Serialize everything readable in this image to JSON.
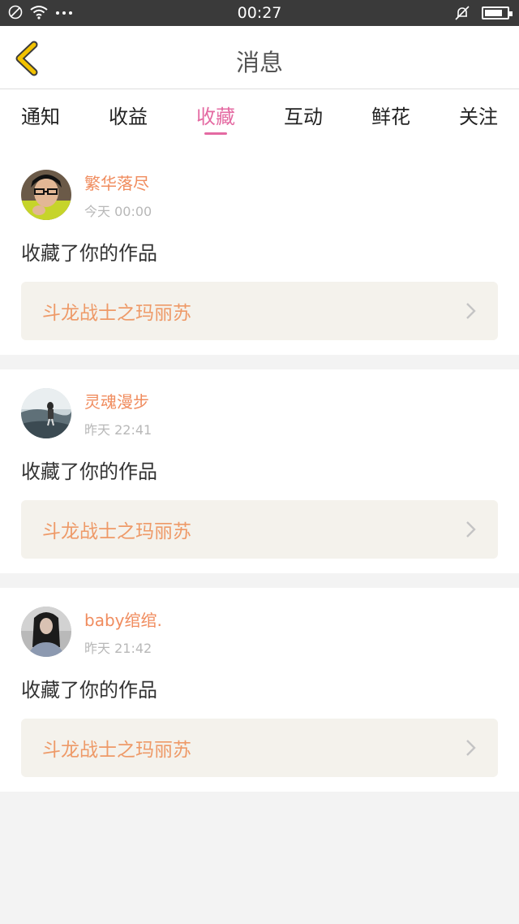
{
  "status": {
    "time": "00:27"
  },
  "nav": {
    "title": "消息"
  },
  "tabs": [
    {
      "label": "通知",
      "active": false
    },
    {
      "label": "收益",
      "active": false
    },
    {
      "label": "收藏",
      "active": true
    },
    {
      "label": "互动",
      "active": false
    },
    {
      "label": "鲜花",
      "active": false
    },
    {
      "label": "关注",
      "active": false
    }
  ],
  "items": [
    {
      "name": "繁华落尽",
      "time": "今天 00:00",
      "action": "收藏了你的作品",
      "work": "斗龙战士之玛丽苏"
    },
    {
      "name": "灵魂漫步",
      "time": "昨天 22:41",
      "action": "收藏了你的作品",
      "work": "斗龙战士之玛丽苏"
    },
    {
      "name": "baby绾绾.",
      "time": "昨天 21:42",
      "action": "收藏了你的作品",
      "work": "斗龙战士之玛丽苏"
    }
  ],
  "colors": {
    "accent": "#e46aa2",
    "username": "#f08c5e",
    "back_icon": "#f2c200"
  }
}
